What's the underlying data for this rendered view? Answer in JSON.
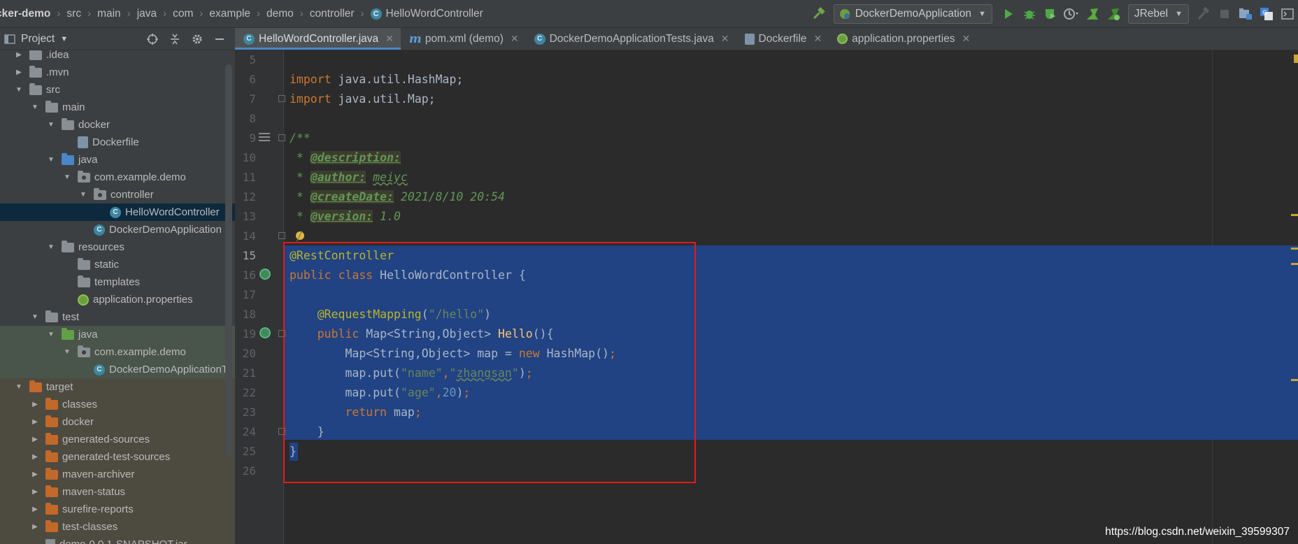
{
  "breadcrumbs": [
    "cker-demo",
    "src",
    "main",
    "java",
    "com",
    "example",
    "demo",
    "controller",
    "HelloWordController"
  ],
  "toolbar": {
    "run_config": "DockerDemoApplication",
    "jrebel": "JRebel"
  },
  "project_panel": {
    "title": "Project"
  },
  "tree": [
    {
      "label": ".idea",
      "indent": 0,
      "icon": "folder-gray",
      "expanded": false
    },
    {
      "label": ".mvn",
      "indent": 0,
      "icon": "folder-gray",
      "expanded": false
    },
    {
      "label": "src",
      "indent": 0,
      "icon": "folder-gray",
      "expanded": true
    },
    {
      "label": "main",
      "indent": 1,
      "icon": "folder-gray",
      "expanded": true
    },
    {
      "label": "docker",
      "indent": 2,
      "icon": "folder-gray",
      "expanded": true
    },
    {
      "label": "Dockerfile",
      "indent": 3,
      "icon": "file",
      "expanded": null
    },
    {
      "label": "java",
      "indent": 2,
      "icon": "folder-blue",
      "expanded": true
    },
    {
      "label": "com.example.demo",
      "indent": 3,
      "icon": "package",
      "expanded": true
    },
    {
      "label": "controller",
      "indent": 4,
      "icon": "package",
      "expanded": true
    },
    {
      "label": "HelloWordController",
      "indent": 5,
      "icon": "class",
      "expanded": null,
      "selected": true
    },
    {
      "label": "DockerDemoApplication",
      "indent": 4,
      "icon": "class-app",
      "expanded": null
    },
    {
      "label": "resources",
      "indent": 2,
      "icon": "folder-res",
      "expanded": true
    },
    {
      "label": "static",
      "indent": 3,
      "icon": "folder-gray",
      "expanded": null
    },
    {
      "label": "templates",
      "indent": 3,
      "icon": "folder-gray",
      "expanded": null
    },
    {
      "label": "application.properties",
      "indent": 3,
      "icon": "props",
      "expanded": null
    },
    {
      "label": "test",
      "indent": 1,
      "icon": "folder-gray",
      "expanded": true
    },
    {
      "label": "java",
      "indent": 2,
      "icon": "folder-green",
      "expanded": true,
      "zone": "test"
    },
    {
      "label": "com.example.demo",
      "indent": 3,
      "icon": "package",
      "expanded": true,
      "zone": "test"
    },
    {
      "label": "DockerDemoApplicationT",
      "indent": 4,
      "icon": "class-app",
      "expanded": null,
      "zone": "test"
    },
    {
      "label": "target",
      "indent": 0,
      "icon": "folder-orange",
      "expanded": true,
      "zone": "target"
    },
    {
      "label": "classes",
      "indent": 1,
      "icon": "folder-orange",
      "expanded": false,
      "zone": "target"
    },
    {
      "label": "docker",
      "indent": 1,
      "icon": "folder-orange",
      "expanded": false,
      "zone": "target"
    },
    {
      "label": "generated-sources",
      "indent": 1,
      "icon": "folder-orange",
      "expanded": false,
      "zone": "target"
    },
    {
      "label": "generated-test-sources",
      "indent": 1,
      "icon": "folder-orange",
      "expanded": false,
      "zone": "target"
    },
    {
      "label": "maven-archiver",
      "indent": 1,
      "icon": "folder-orange",
      "expanded": false,
      "zone": "target"
    },
    {
      "label": "maven-status",
      "indent": 1,
      "icon": "folder-orange",
      "expanded": false,
      "zone": "target"
    },
    {
      "label": "surefire-reports",
      "indent": 1,
      "icon": "folder-orange",
      "expanded": false,
      "zone": "target"
    },
    {
      "label": "test-classes",
      "indent": 1,
      "icon": "folder-orange",
      "expanded": false,
      "zone": "target"
    },
    {
      "label": "demo-0.0.1-SNAPSHOT.jar",
      "indent": 1,
      "icon": "jar",
      "expanded": null,
      "zone": "target"
    }
  ],
  "tabs": [
    {
      "label": "HelloWordController.java",
      "icon": "class",
      "active": true
    },
    {
      "label": "pom.xml (demo)",
      "icon": "maven",
      "active": false
    },
    {
      "label": "DockerDemoApplicationTests.java",
      "icon": "class",
      "active": false
    },
    {
      "label": "Dockerfile",
      "icon": "file",
      "active": false
    },
    {
      "label": "application.properties",
      "icon": "props",
      "active": false
    }
  ],
  "editor": {
    "line_numbers": [
      "5",
      "6",
      "7",
      "8",
      "9",
      "10",
      "11",
      "12",
      "13",
      "14",
      "15",
      "16",
      "17",
      "18",
      "19",
      "20",
      "21",
      "22",
      "23",
      "24",
      "25",
      "26"
    ],
    "current_line": "15",
    "code": {
      "l6_kw": "import",
      "l6_rest": " java.util.HashMap;",
      "l7_kw": "import",
      "l7_rest": " java.util.Map;",
      "l9": "/**",
      "l10_pre": " * ",
      "l10_tag": "@description:",
      "l11_pre": " * ",
      "l11_tag": "@author:",
      "l11_val": "meiyc",
      "l12_pre": " * ",
      "l12_tag": "@createDate:",
      "l12_val": " 2021/8/10 20:54",
      "l13_pre": " * ",
      "l13_tag": "@version:",
      "l13_val": " 1.0",
      "l14": " /",
      "l15": "@RestController",
      "l16_kw1": "public",
      "l16_kw2": "class",
      "l16_rest": " HelloWordController {",
      "l18_ann": "    @RequestMapping",
      "l18_p1": "(",
      "l18_str": "\"/hello\"",
      "l18_p2": ")",
      "l19_kw": "    public",
      "l19_type": " Map<String,Object> ",
      "l19_fn": "Hello",
      "l19_rest": "(){",
      "l20_type": "        Map<String,Object> map = ",
      "l20_kw": "new",
      "l20_rest": " HashMap()",
      "l20_semi": ";",
      "l21_pre": "        map.put(",
      "l21_s1": "\"name\"",
      "l21_comma": ",",
      "l21_s2a": "\"",
      "l21_s2b": "zhangsan",
      "l21_s2c": "\"",
      "l21_post": ")",
      "l21_semi": ";",
      "l22_pre": "        map.put(",
      "l22_s1": "\"age\"",
      "l22_comma": ",",
      "l22_num": "20",
      "l22_post": ")",
      "l22_semi": ";",
      "l23_kw": "        return",
      "l23_rest": " map",
      "l23_semi": ";",
      "l24": "    }",
      "l25": "}"
    }
  },
  "watermark": "https://blog.csdn.net/weixin_39599307"
}
